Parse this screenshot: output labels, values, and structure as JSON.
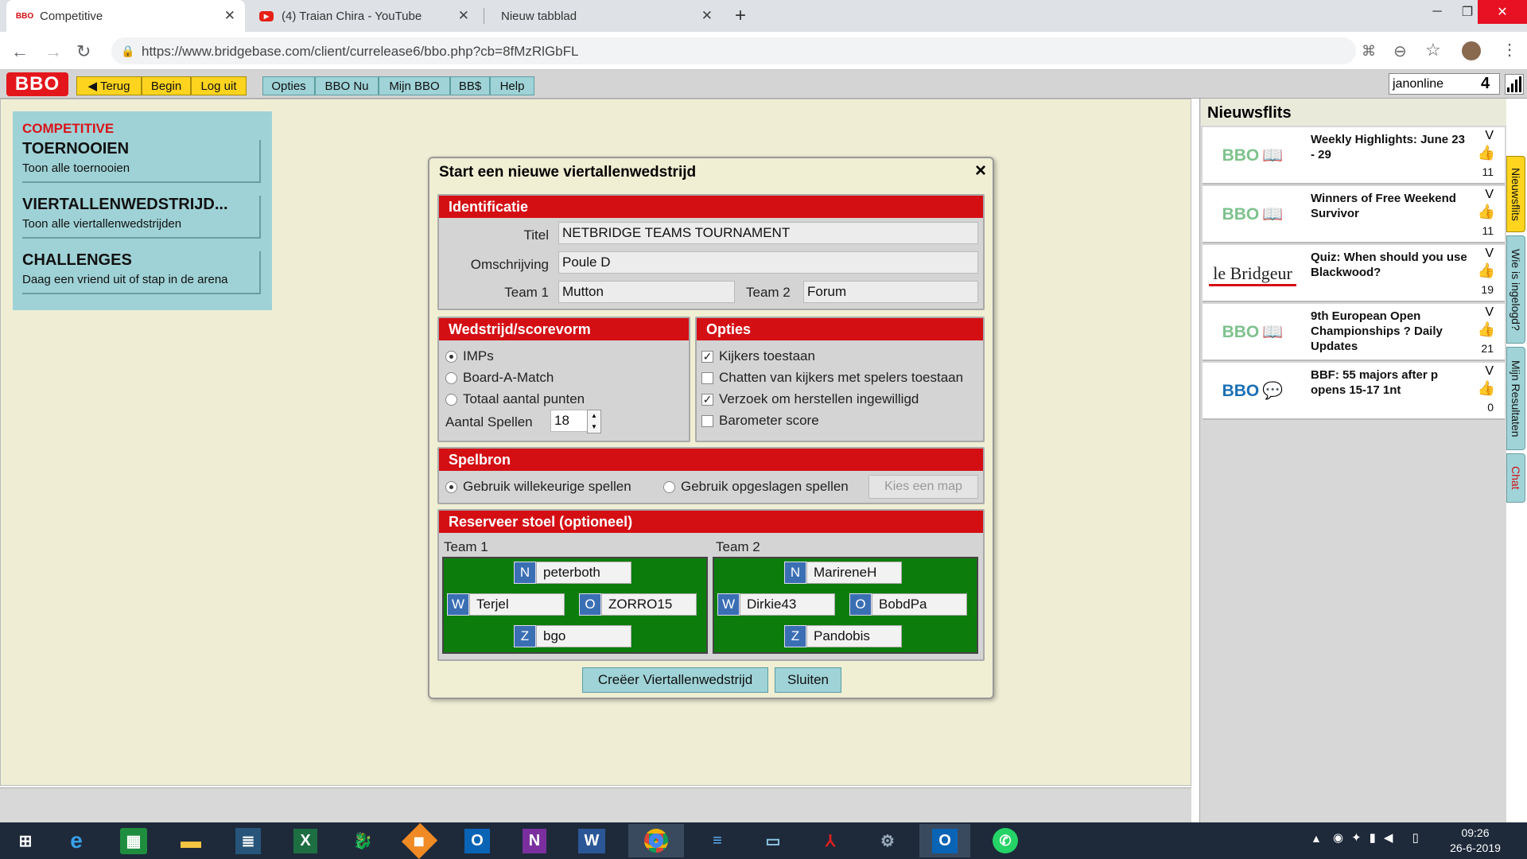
{
  "browser": {
    "tabs": [
      {
        "label": "Competitive",
        "favicon": "BBO"
      },
      {
        "label": "(4) Traian Chira - YouTube",
        "favicon": "youtube-icon"
      },
      {
        "label": "Nieuw tabblad",
        "favicon": ""
      }
    ],
    "new_tab": "+",
    "url": "https://www.bridgebase.com/client/currelease6/bbo.php?cb=8fMzRlGbFL"
  },
  "bbo": {
    "logo": "BBO",
    "yellow_buttons": [
      "◀ Terug",
      "Begin",
      "Log uit"
    ],
    "menu_buttons": [
      "Opties",
      "BBO Nu",
      "Mijn BBO",
      "BB$",
      "Help"
    ],
    "username": "janonline",
    "user_count": "4"
  },
  "left_panel": {
    "title": "COMPETITIVE",
    "items": [
      {
        "head": "TOERNOOIEN",
        "sub": "Toon alle toernooien"
      },
      {
        "head": "VIERTALLENWEDSTRIJD...",
        "sub": "Toon alle viertallenwedstrijden"
      },
      {
        "head": "CHALLENGES",
        "sub": "Daag een vriend uit of stap in de arena"
      }
    ]
  },
  "dialog": {
    "title": "Start een nieuwe viertallenwedstrijd",
    "close": "×",
    "identificatie": {
      "header": "Identificatie",
      "titel_label": "Titel",
      "titel_value": "NETBRIDGE TEAMS TOURNAMENT",
      "omschrijving_label": "Omschrijving",
      "omschrijving_value": "Poule D",
      "team1_label": "Team 1",
      "team1_value": "Mutton",
      "team2_label": "Team 2",
      "team2_value": "Forum"
    },
    "scorevorm": {
      "header": "Wedstrijd/scorevorm",
      "options": [
        "IMPs",
        "Board-A-Match",
        "Totaal aantal punten"
      ],
      "selected": 0,
      "aantal_label": "Aantal Spellen",
      "aantal_value": "18"
    },
    "opties": {
      "header": "Opties",
      "items": [
        {
          "label": "Kijkers toestaan",
          "checked": true
        },
        {
          "label": "Chatten van kijkers met spelers toestaan",
          "checked": false
        },
        {
          "label": "Verzoek om herstellen ingewilligd",
          "checked": true
        },
        {
          "label": "Barometer score",
          "checked": false
        }
      ]
    },
    "spelbron": {
      "header": "Spelbron",
      "options": [
        "Gebruik willekeurige spellen",
        "Gebruik opgeslagen spellen"
      ],
      "selected": 0,
      "button": "Kies een map"
    },
    "reserveer": {
      "header": "Reserveer stoel (optioneel)",
      "team1_label": "Team 1",
      "team2_label": "Team 2",
      "team1": {
        "N": "peterboth",
        "W": "Terjel",
        "O": "ZORRO15",
        "Z": "bgo"
      },
      "team2": {
        "N": "MarireneH",
        "W": "Dirkie43",
        "O": "BobdPa",
        "Z": "Pandobis"
      },
      "dirs": {
        "N": "N",
        "W": "W",
        "O": "O",
        "Z": "Z"
      }
    },
    "create_button": "Creëer Viertallenwedstrijd",
    "close_button": "Sluiten"
  },
  "news": {
    "header": "Nieuwsflits",
    "items": [
      {
        "logo": "BBO",
        "title": "Weekly Highlights: June 23 - 29",
        "count": "11"
      },
      {
        "logo": "BBO",
        "title": "Winners of Free Weekend Survivor",
        "count": "11"
      },
      {
        "logo": "le Bridgeur",
        "title": "Quiz: When should you use Blackwood?",
        "count": "19"
      },
      {
        "logo": "BBO",
        "title": "9th European Open Championships ? Daily Updates",
        "count": "21"
      },
      {
        "logo": "BBO",
        "title": "BBF: 55 majors after p opens 15-17 1nt",
        "count": "0"
      }
    ],
    "vtabs": [
      "Nieuwsflits",
      "Wie is ingelogd?",
      "Mijn Resultaten",
      "Chat"
    ]
  },
  "taskbar": {
    "time": "09:26",
    "date": "26-6-2019"
  }
}
